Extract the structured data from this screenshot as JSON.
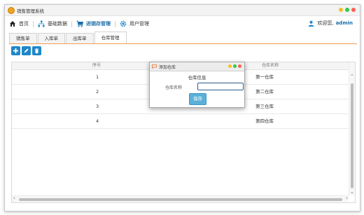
{
  "window": {
    "title": "销售管理系统"
  },
  "nav": {
    "items": [
      {
        "label": "首页",
        "icon": "home-icon"
      },
      {
        "label": "基础数据",
        "icon": "sitemap-icon"
      },
      {
        "label": "进销存管理",
        "icon": "cart-icon",
        "active": true
      },
      {
        "label": "用户管理",
        "icon": "gear-icon"
      }
    ],
    "welcome": "欢迎您,",
    "user": "admin"
  },
  "tabs": [
    {
      "label": "销售单"
    },
    {
      "label": "入库单"
    },
    {
      "label": "出库单"
    },
    {
      "label": "仓库管理",
      "active": true
    }
  ],
  "toolbar": {
    "add": "add-icon",
    "edit": "edit-icon",
    "delete": "delete-icon"
  },
  "table": {
    "columns": [
      "序号",
      "仓库名称"
    ],
    "rows": [
      [
        "1",
        "第一仓库"
      ],
      [
        "2",
        "第二仓库"
      ],
      [
        "3",
        "第三仓库"
      ],
      [
        "4",
        "第四仓库"
      ]
    ]
  },
  "dialog": {
    "title": "添加仓库",
    "heading": "仓库信息",
    "field_label": "仓库名称",
    "field_value": "",
    "save_label": "保存"
  },
  "colors": {
    "accent": "#1e87c8",
    "active_nav": "#1a6ea8",
    "tab_underline": "#f0a050",
    "save_button": "#5ab0d8"
  }
}
